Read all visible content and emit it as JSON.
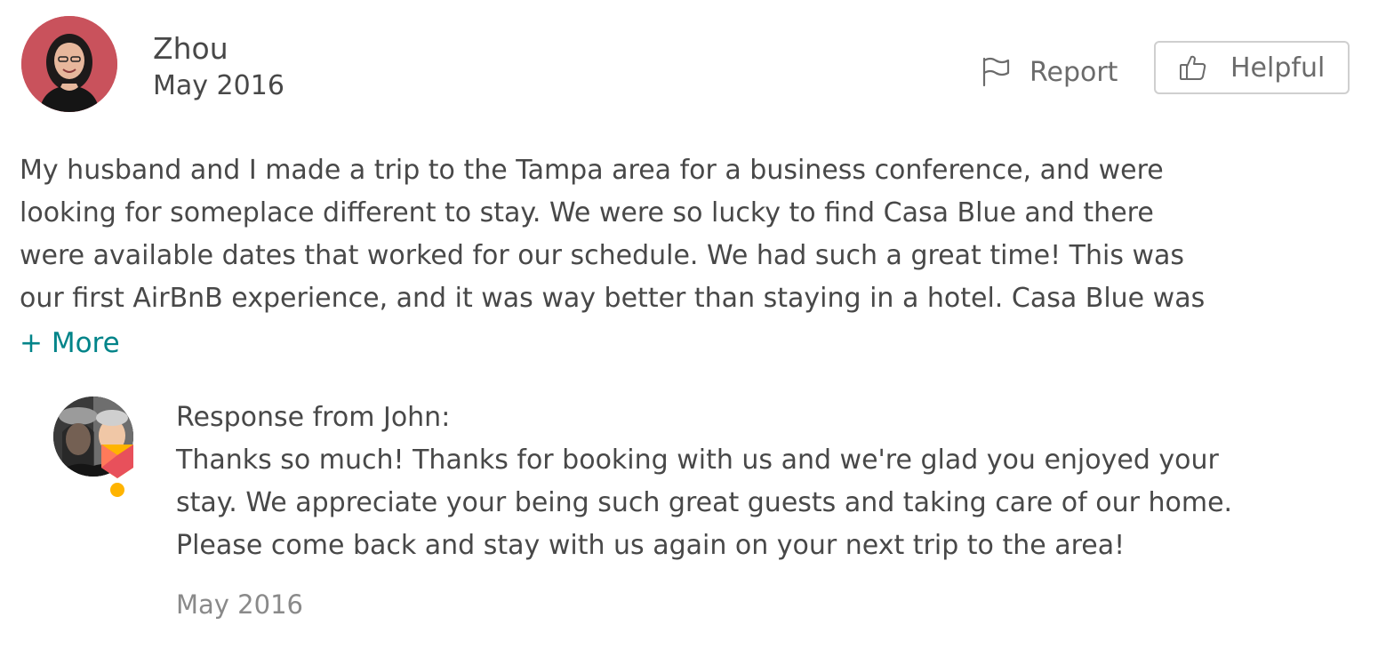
{
  "review": {
    "reviewer_name": "Zhou",
    "date": "May 2016",
    "text_lines": [
      "My husband and I made a trip to the Tampa area for a business conference, and were",
      "looking for someplace different to stay.  We were so lucky to find Casa Blue and there",
      "were available dates that worked for our schedule. We had such a great time! This was",
      "our first AirBnB experience, and it was way better than staying in a hotel.  Casa Blue was"
    ],
    "more_label": "+ More"
  },
  "actions": {
    "report_label": "Report",
    "report_icon": "flag-icon",
    "helpful_label": "Helpful",
    "helpful_icon": "thumbs-up-icon"
  },
  "response": {
    "title": "Response from John:",
    "text_lines": [
      "Thanks so much! Thanks for booking with us and we're glad you enjoyed your",
      "stay. We appreciate your being such great guests and taking care of our home.",
      "Please come back and stay with us again on your next trip to the area!"
    ],
    "date": "May 2016"
  },
  "colors": {
    "text": "#484848",
    "muted": "#6b6b6b",
    "link": "#008489",
    "border": "#cfcfcf",
    "badge_red": "#e8505b",
    "badge_yellow": "#ffb400"
  }
}
